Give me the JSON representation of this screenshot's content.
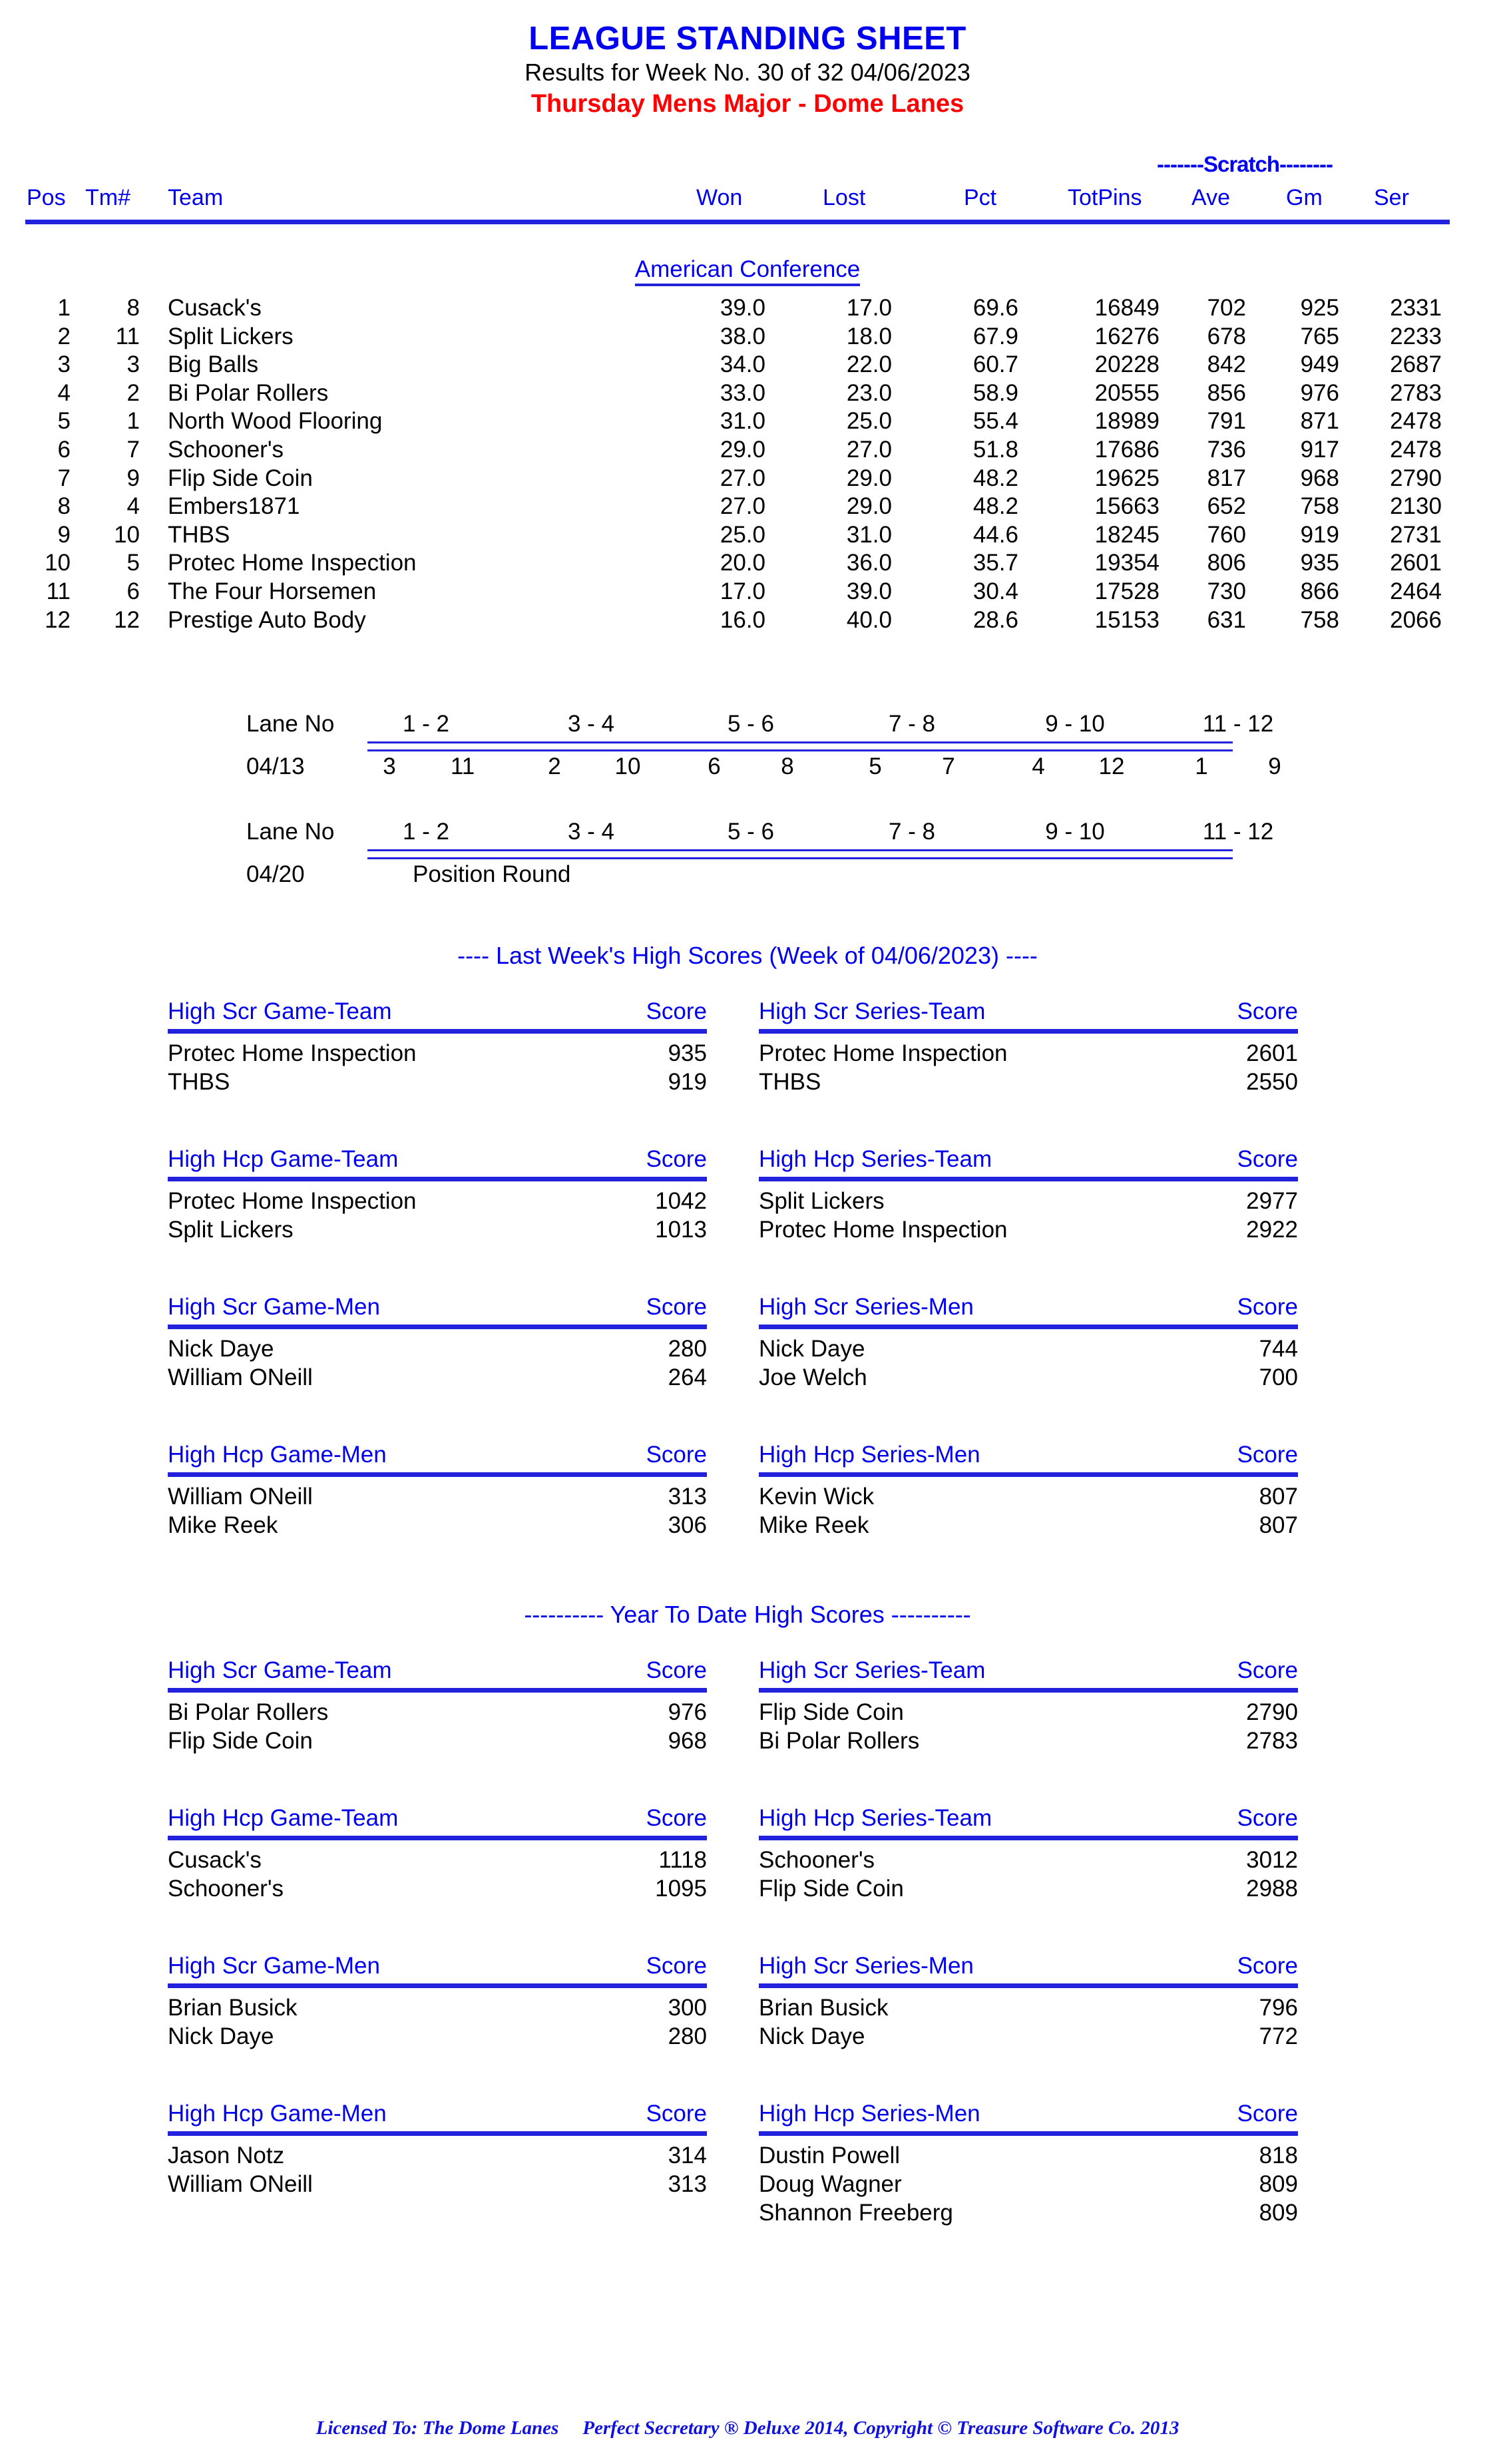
{
  "header": {
    "title": "LEAGUE STANDING SHEET",
    "results_line": "Results for Week No. 30 of 32    04/06/2023",
    "league_line": "Thursday Mens Major - Dome Lanes"
  },
  "standings": {
    "scratch_group_label": "-------Scratch--------",
    "columns": {
      "pos": "Pos",
      "tm": "Tm#",
      "team": "Team",
      "won": "Won",
      "lost": "Lost",
      "pct": "Pct",
      "totpins": "TotPins",
      "ave": "Ave",
      "gm": "Gm",
      "ser": "Ser"
    },
    "conference": "American Conference",
    "rows": [
      {
        "pos": "1",
        "tm": "8",
        "team": "Cusack's",
        "won": "39.0",
        "lost": "17.0",
        "pct": "69.6",
        "totpins": "16849",
        "ave": "702",
        "gm": "925",
        "ser": "2331"
      },
      {
        "pos": "2",
        "tm": "11",
        "team": "Split Lickers",
        "won": "38.0",
        "lost": "18.0",
        "pct": "67.9",
        "totpins": "16276",
        "ave": "678",
        "gm": "765",
        "ser": "2233"
      },
      {
        "pos": "3",
        "tm": "3",
        "team": "Big Balls",
        "won": "34.0",
        "lost": "22.0",
        "pct": "60.7",
        "totpins": "20228",
        "ave": "842",
        "gm": "949",
        "ser": "2687"
      },
      {
        "pos": "4",
        "tm": "2",
        "team": "Bi Polar Rollers",
        "won": "33.0",
        "lost": "23.0",
        "pct": "58.9",
        "totpins": "20555",
        "ave": "856",
        "gm": "976",
        "ser": "2783"
      },
      {
        "pos": "5",
        "tm": "1",
        "team": "North Wood Flooring",
        "won": "31.0",
        "lost": "25.0",
        "pct": "55.4",
        "totpins": "18989",
        "ave": "791",
        "gm": "871",
        "ser": "2478"
      },
      {
        "pos": "6",
        "tm": "7",
        "team": "Schooner's",
        "won": "29.0",
        "lost": "27.0",
        "pct": "51.8",
        "totpins": "17686",
        "ave": "736",
        "gm": "917",
        "ser": "2478"
      },
      {
        "pos": "7",
        "tm": "9",
        "team": "Flip Side Coin",
        "won": "27.0",
        "lost": "29.0",
        "pct": "48.2",
        "totpins": "19625",
        "ave": "817",
        "gm": "968",
        "ser": "2790"
      },
      {
        "pos": "8",
        "tm": "4",
        "team": "Embers1871",
        "won": "27.0",
        "lost": "29.0",
        "pct": "48.2",
        "totpins": "15663",
        "ave": "652",
        "gm": "758",
        "ser": "2130"
      },
      {
        "pos": "9",
        "tm": "10",
        "team": "THBS",
        "won": "25.0",
        "lost": "31.0",
        "pct": "44.6",
        "totpins": "18245",
        "ave": "760",
        "gm": "919",
        "ser": "2731"
      },
      {
        "pos": "10",
        "tm": "5",
        "team": "Protec Home Inspection",
        "won": "20.0",
        "lost": "36.0",
        "pct": "35.7",
        "totpins": "19354",
        "ave": "806",
        "gm": "935",
        "ser": "2601"
      },
      {
        "pos": "11",
        "tm": "6",
        "team": "The Four Horsemen",
        "won": "17.0",
        "lost": "39.0",
        "pct": "30.4",
        "totpins": "17528",
        "ave": "730",
        "gm": "866",
        "ser": "2464"
      },
      {
        "pos": "12",
        "tm": "12",
        "team": "Prestige Auto Body",
        "won": "16.0",
        "lost": "40.0",
        "pct": "28.6",
        "totpins": "15153",
        "ave": "631",
        "gm": "758",
        "ser": "2066"
      }
    ]
  },
  "schedule": {
    "lane_no_label": "Lane No",
    "lane_pairs": [
      "1 - 2",
      "3 - 4",
      "5 - 6",
      "7 - 8",
      "9 - 10",
      "11 - 12"
    ],
    "weeks": [
      {
        "date": "04/13",
        "matchups": [
          {
            "a": "3",
            "b": "11"
          },
          {
            "a": "2",
            "b": "10"
          },
          {
            "a": "6",
            "b": "8"
          },
          {
            "a": "5",
            "b": "7"
          },
          {
            "a": "4",
            "b": "12"
          },
          {
            "a": "1",
            "b": "9"
          }
        ],
        "note": ""
      },
      {
        "date": "04/20",
        "matchups": [],
        "note": "Position Round"
      }
    ]
  },
  "last_week": {
    "heading": "----  Last Week's High Scores   (Week of 04/06/2023)  ----",
    "score_label": "Score",
    "panels": [
      {
        "title": "High Scr Game-Team",
        "rows": [
          {
            "name": "Protec Home Inspection",
            "score": "935"
          },
          {
            "name": "THBS",
            "score": "919"
          }
        ]
      },
      {
        "title": "High Scr Series-Team",
        "rows": [
          {
            "name": "Protec Home Inspection",
            "score": "2601"
          },
          {
            "name": "THBS",
            "score": "2550"
          }
        ]
      },
      {
        "title": "High Hcp Game-Team",
        "rows": [
          {
            "name": "Protec Home Inspection",
            "score": "1042"
          },
          {
            "name": "Split Lickers",
            "score": "1013"
          }
        ]
      },
      {
        "title": "High Hcp Series-Team",
        "rows": [
          {
            "name": "Split Lickers",
            "score": "2977"
          },
          {
            "name": "Protec Home Inspection",
            "score": "2922"
          }
        ]
      },
      {
        "title": "High Scr Game-Men",
        "rows": [
          {
            "name": "Nick Daye",
            "score": "280"
          },
          {
            "name": "William ONeill",
            "score": "264"
          }
        ]
      },
      {
        "title": "High Scr Series-Men",
        "rows": [
          {
            "name": "Nick Daye",
            "score": "744"
          },
          {
            "name": "Joe Welch",
            "score": "700"
          }
        ]
      },
      {
        "title": "High Hcp Game-Men",
        "rows": [
          {
            "name": "William ONeill",
            "score": "313"
          },
          {
            "name": "Mike Reek",
            "score": "306"
          }
        ]
      },
      {
        "title": "High Hcp Series-Men",
        "rows": [
          {
            "name": "Kevin Wick",
            "score": "807"
          },
          {
            "name": "Mike Reek",
            "score": "807"
          }
        ]
      }
    ]
  },
  "year_to_date": {
    "heading": "----------  Year To Date High Scores  ----------",
    "score_label": "Score",
    "panels": [
      {
        "title": "High Scr Game-Team",
        "rows": [
          {
            "name": "Bi Polar Rollers",
            "score": "976"
          },
          {
            "name": "Flip Side Coin",
            "score": "968"
          }
        ]
      },
      {
        "title": "High Scr Series-Team",
        "rows": [
          {
            "name": "Flip Side Coin",
            "score": "2790"
          },
          {
            "name": "Bi Polar Rollers",
            "score": "2783"
          }
        ]
      },
      {
        "title": "High Hcp Game-Team",
        "rows": [
          {
            "name": "Cusack's",
            "score": "1118"
          },
          {
            "name": "Schooner's",
            "score": "1095"
          }
        ]
      },
      {
        "title": "High Hcp Series-Team",
        "rows": [
          {
            "name": "Schooner's",
            "score": "3012"
          },
          {
            "name": "Flip Side Coin",
            "score": "2988"
          }
        ]
      },
      {
        "title": "High Scr Game-Men",
        "rows": [
          {
            "name": "Brian Busick",
            "score": "300"
          },
          {
            "name": "Nick Daye",
            "score": "280"
          }
        ]
      },
      {
        "title": "High Scr Series-Men",
        "rows": [
          {
            "name": "Brian Busick",
            "score": "796"
          },
          {
            "name": "Nick Daye",
            "score": "772"
          }
        ]
      },
      {
        "title": "High Hcp Game-Men",
        "rows": [
          {
            "name": "Jason Notz",
            "score": "314"
          },
          {
            "name": "William ONeill",
            "score": "313"
          }
        ]
      },
      {
        "title": "High Hcp Series-Men",
        "rows": [
          {
            "name": "Dustin Powell",
            "score": "818"
          },
          {
            "name": "Doug Wagner",
            "score": "809"
          },
          {
            "name": "Shannon Freeberg",
            "score": "809"
          }
        ]
      }
    ]
  },
  "footer": {
    "licensed_to": "Licensed To: The Dome Lanes",
    "product": "Perfect Secretary ® Deluxe  2014, Copyright © Treasure Software Co. 2013"
  },
  "colors": {
    "accent_blue": "#0000ee",
    "rule_blue": "#2222dd",
    "league_red": "#ff0000"
  }
}
